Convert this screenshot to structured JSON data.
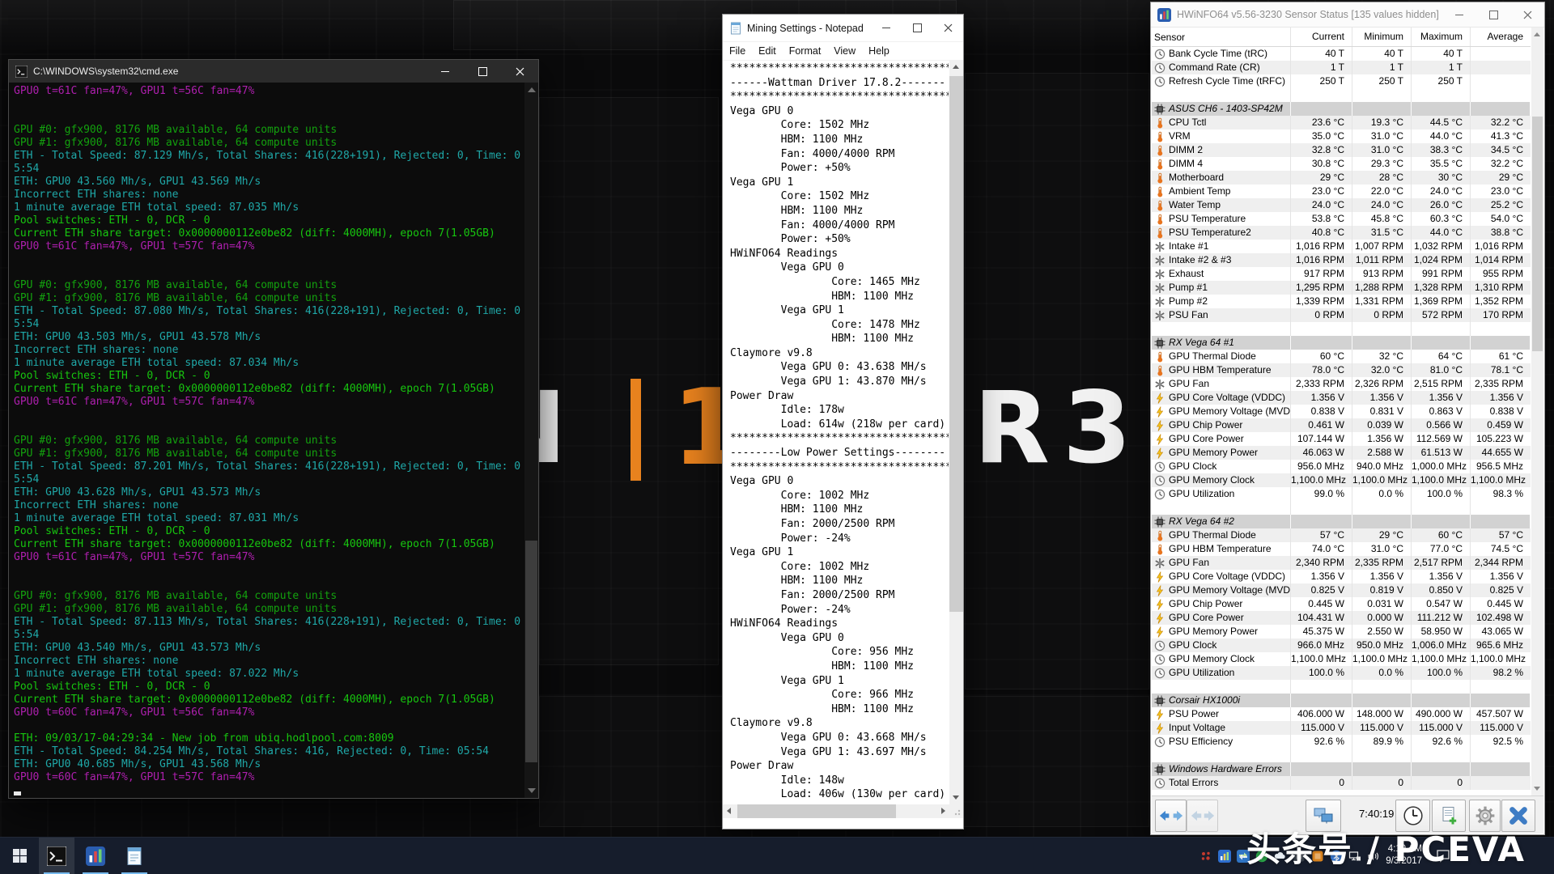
{
  "wallpaper": {
    "letter_n": "N",
    "digit_one": "1",
    "letters_r3": "R3"
  },
  "watermark": {
    "text": "头条号 / PCEVA"
  },
  "cmd": {
    "title": "C:\\WINDOWS\\system32\\cmd.exe",
    "lines": [
      {
        "t": "GPU0 t=61C fan=47%, GPU1 t=56C fan=47%",
        "c": "m"
      },
      {
        "t": ""
      },
      {
        "t": ""
      },
      {
        "t": "GPU #0: gfx900, 8176 MB available, 64 compute units",
        "c": "g"
      },
      {
        "t": "GPU #1: gfx900, 8176 MB available, 64 compute units",
        "c": "g"
      },
      {
        "t": "ETH - Total Speed: 87.129 Mh/s, Total Shares: 416(228+191), Rejected: 0, Time: 0",
        "c": "c"
      },
      {
        "t": "5:54",
        "c": "c"
      },
      {
        "t": "ETH: GPU0 43.560 Mh/s, GPU1 43.569 Mh/s",
        "c": "c"
      },
      {
        "t": "Incorrect ETH shares: none",
        "c": "c"
      },
      {
        "t": "1 minute average ETH total speed: 87.035 Mh/s",
        "c": "c"
      },
      {
        "t": "Pool switches: ETH - 0, DCR - 0",
        "c": "b"
      },
      {
        "t": "Current ETH share target: 0x0000000112e0be82 (diff: 4000MH), epoch 7(1.05GB)",
        "c": "b"
      },
      {
        "t": "GPU0 t=61C fan=47%, GPU1 t=57C fan=47%",
        "c": "m"
      },
      {
        "t": ""
      },
      {
        "t": ""
      },
      {
        "t": "GPU #0: gfx900, 8176 MB available, 64 compute units",
        "c": "g"
      },
      {
        "t": "GPU #1: gfx900, 8176 MB available, 64 compute units",
        "c": "g"
      },
      {
        "t": "ETH - Total Speed: 87.080 Mh/s, Total Shares: 416(228+191), Rejected: 0, Time: 0",
        "c": "c"
      },
      {
        "t": "5:54",
        "c": "c"
      },
      {
        "t": "ETH: GPU0 43.503 Mh/s, GPU1 43.578 Mh/s",
        "c": "c"
      },
      {
        "t": "Incorrect ETH shares: none",
        "c": "c"
      },
      {
        "t": "1 minute average ETH total speed: 87.034 Mh/s",
        "c": "c"
      },
      {
        "t": "Pool switches: ETH - 0, DCR - 0",
        "c": "b"
      },
      {
        "t": "Current ETH share target: 0x0000000112e0be82 (diff: 4000MH), epoch 7(1.05GB)",
        "c": "b"
      },
      {
        "t": "GPU0 t=61C fan=47%, GPU1 t=57C fan=47%",
        "c": "m"
      },
      {
        "t": ""
      },
      {
        "t": ""
      },
      {
        "t": "GPU #0: gfx900, 8176 MB available, 64 compute units",
        "c": "g"
      },
      {
        "t": "GPU #1: gfx900, 8176 MB available, 64 compute units",
        "c": "g"
      },
      {
        "t": "ETH - Total Speed: 87.201 Mh/s, Total Shares: 416(228+191), Rejected: 0, Time: 0",
        "c": "c"
      },
      {
        "t": "5:54",
        "c": "c"
      },
      {
        "t": "ETH: GPU0 43.628 Mh/s, GPU1 43.573 Mh/s",
        "c": "c"
      },
      {
        "t": "Incorrect ETH shares: none",
        "c": "c"
      },
      {
        "t": "1 minute average ETH total speed: 87.031 Mh/s",
        "c": "c"
      },
      {
        "t": "Pool switches: ETH - 0, DCR - 0",
        "c": "b"
      },
      {
        "t": "Current ETH share target: 0x0000000112e0be82 (diff: 4000MH), epoch 7(1.05GB)",
        "c": "b"
      },
      {
        "t": "GPU0 t=61C fan=47%, GPU1 t=57C fan=47%",
        "c": "m"
      },
      {
        "t": ""
      },
      {
        "t": ""
      },
      {
        "t": "GPU #0: gfx900, 8176 MB available, 64 compute units",
        "c": "g"
      },
      {
        "t": "GPU #1: gfx900, 8176 MB available, 64 compute units",
        "c": "g"
      },
      {
        "t": "ETH - Total Speed: 87.113 Mh/s, Total Shares: 416(228+191), Rejected: 0, Time: 0",
        "c": "c"
      },
      {
        "t": "5:54",
        "c": "c"
      },
      {
        "t": "ETH: GPU0 43.540 Mh/s, GPU1 43.573 Mh/s",
        "c": "c"
      },
      {
        "t": "Incorrect ETH shares: none",
        "c": "c"
      },
      {
        "t": "1 minute average ETH total speed: 87.022 Mh/s",
        "c": "c"
      },
      {
        "t": "Pool switches: ETH - 0, DCR - 0",
        "c": "b"
      },
      {
        "t": "Current ETH share target: 0x0000000112e0be82 (diff: 4000MH), epoch 7(1.05GB)",
        "c": "b"
      },
      {
        "t": "GPU0 t=60C fan=47%, GPU1 t=56C fan=47%",
        "c": "m"
      },
      {
        "t": ""
      },
      {
        "t": "ETH: 09/03/17-04:29:34 - New job from ubiq.hodlpool.com:8009",
        "c": "b"
      },
      {
        "t": "ETH - Total Speed: 84.254 Mh/s, Total Shares: 416, Rejected: 0, Time: 05:54",
        "c": "c"
      },
      {
        "t": "ETH: GPU0 40.685 Mh/s, GPU1 43.568 Mh/s",
        "c": "c"
      },
      {
        "t": "GPU0 t=60C fan=47%, GPU1 t=57C fan=47%",
        "c": "m"
      },
      {
        "cursor": true
      }
    ]
  },
  "notepad": {
    "title": "Mining Settings - Notepad",
    "menu": [
      "File",
      "Edit",
      "Format",
      "View",
      "Help"
    ],
    "lines": [
      "***********************************",
      "------Wattman Driver 17.8.2-------",
      "***********************************",
      "Vega GPU 0",
      "        Core: 1502 MHz",
      "        HBM: 1100 MHz",
      "        Fan: 4000/4000 RPM",
      "        Power: +50%",
      "Vega GPU 1",
      "        Core: 1502 MHz",
      "        HBM: 1100 MHz",
      "        Fan: 4000/4000 RPM",
      "        Power: +50%",
      "HWiNFO64 Readings",
      "        Vega GPU 0",
      "                Core: 1465 MHz",
      "                HBM: 1100 MHz",
      "        Vega GPU 1",
      "                Core: 1478 MHz",
      "                HBM: 1100 MHz",
      "Claymore v9.8",
      "        Vega GPU 0: 43.638 MH/s",
      "        Vega GPU 1: 43.870 MH/s",
      "Power Draw",
      "        Idle: 178w",
      "        Load: 614w (218w per card)",
      "***********************************",
      "--------Low Power Settings--------",
      "***********************************",
      "Vega GPU 0",
      "        Core: 1002 MHz",
      "        HBM: 1100 MHz",
      "        Fan: 2000/2500 RPM",
      "        Power: -24%",
      "Vega GPU 1",
      "        Core: 1002 MHz",
      "        HBM: 1100 MHz",
      "        Fan: 2000/2500 RPM",
      "        Power: -24%",
      "HWiNFO64 Readings",
      "        Vega GPU 0",
      "                Core: 956 MHz",
      "                HBM: 1100 MHz",
      "        Vega GPU 1",
      "                Core: 966 MHz",
      "                HBM: 1100 MHz",
      "Claymore v9.8",
      "        Vega GPU 0: 43.668 MH/s",
      "        Vega GPU 1: 43.697 MH/s",
      "Power Draw",
      "        Idle: 148w",
      "        Load: 406w (130w per card)"
    ]
  },
  "hwinfo": {
    "title": "HWiNFO64 v5.56-3230 Sensor Status [135 values hidden]",
    "columns": [
      "Sensor",
      "Current",
      "Minimum",
      "Maximum",
      "Average"
    ],
    "toolbar": {
      "time": "7:40:19"
    },
    "groups": [
      {
        "rows": [
          {
            "icon": "clock",
            "label": "Bank Cycle Time (tRC)",
            "values": [
              "40 T",
              "40 T",
              "40 T",
              ""
            ]
          },
          {
            "icon": "clock",
            "label": "Command Rate (CR)",
            "values": [
              "1 T",
              "1 T",
              "1 T",
              ""
            ]
          },
          {
            "icon": "clock",
            "label": "Refresh Cycle Time (tRFC)",
            "values": [
              "250 T",
              "250 T",
              "250 T",
              ""
            ]
          }
        ]
      },
      {
        "name": "ASUS CH6 -  1403-SP42M",
        "rows": [
          {
            "icon": "thermo",
            "label": "CPU Tctl",
            "values": [
              "23.6 °C",
              "19.3 °C",
              "44.5 °C",
              "32.2 °C"
            ]
          },
          {
            "icon": "thermo",
            "label": "VRM",
            "values": [
              "35.0 °C",
              "31.0 °C",
              "44.0 °C",
              "41.3 °C"
            ]
          },
          {
            "icon": "thermo",
            "label": "DIMM 2",
            "values": [
              "32.8 °C",
              "31.0 °C",
              "38.3 °C",
              "34.5 °C"
            ]
          },
          {
            "icon": "thermo",
            "label": "DIMM 4",
            "values": [
              "30.8 °C",
              "29.3 °C",
              "35.5 °C",
              "32.2 °C"
            ]
          },
          {
            "icon": "thermo",
            "label": "Motherboard",
            "values": [
              "29 °C",
              "28 °C",
              "30 °C",
              "29 °C"
            ]
          },
          {
            "icon": "thermo",
            "label": "Ambient Temp",
            "values": [
              "23.0 °C",
              "22.0 °C",
              "24.0 °C",
              "23.0 °C"
            ]
          },
          {
            "icon": "thermo",
            "label": "Water Temp",
            "values": [
              "24.0 °C",
              "24.0 °C",
              "26.0 °C",
              "25.2 °C"
            ]
          },
          {
            "icon": "thermo",
            "label": "PSU Temperature",
            "values": [
              "53.8 °C",
              "45.8 °C",
              "60.3 °C",
              "54.0 °C"
            ]
          },
          {
            "icon": "thermo",
            "label": "PSU Temperature2",
            "values": [
              "40.8 °C",
              "31.5 °C",
              "44.0 °C",
              "38.8 °C"
            ]
          },
          {
            "icon": "fan",
            "label": "Intake #1",
            "values": [
              "1,016 RPM",
              "1,007 RPM",
              "1,032 RPM",
              "1,016 RPM"
            ]
          },
          {
            "icon": "fan",
            "label": "Intake #2 & #3",
            "values": [
              "1,016 RPM",
              "1,011 RPM",
              "1,024 RPM",
              "1,014 RPM"
            ]
          },
          {
            "icon": "fan",
            "label": "Exhaust",
            "values": [
              "917 RPM",
              "913 RPM",
              "991 RPM",
              "955 RPM"
            ]
          },
          {
            "icon": "fan",
            "label": "Pump #1",
            "values": [
              "1,295 RPM",
              "1,288 RPM",
              "1,328 RPM",
              "1,310 RPM"
            ]
          },
          {
            "icon": "fan",
            "label": "Pump #2",
            "values": [
              "1,339 RPM",
              "1,331 RPM",
              "1,369 RPM",
              "1,352 RPM"
            ]
          },
          {
            "icon": "fan",
            "label": "PSU Fan",
            "values": [
              "0 RPM",
              "0 RPM",
              "572 RPM",
              "170 RPM"
            ]
          }
        ]
      },
      {
        "name": "RX Vega 64 #1",
        "rows": [
          {
            "icon": "thermo",
            "label": "GPU Thermal Diode",
            "values": [
              "60 °C",
              "32 °C",
              "64 °C",
              "61 °C"
            ]
          },
          {
            "icon": "thermo",
            "label": "GPU HBM Temperature",
            "values": [
              "78.0 °C",
              "32.0 °C",
              "81.0 °C",
              "78.1 °C"
            ]
          },
          {
            "icon": "fan",
            "label": "GPU Fan",
            "values": [
              "2,333 RPM",
              "2,326 RPM",
              "2,515 RPM",
              "2,335 RPM"
            ]
          },
          {
            "icon": "bolt",
            "label": "GPU Core Voltage (VDDC)",
            "values": [
              "1.356 V",
              "1.356 V",
              "1.356 V",
              "1.356 V"
            ]
          },
          {
            "icon": "bolt",
            "label": "GPU Memory Voltage (MVDDC)",
            "values": [
              "0.838 V",
              "0.831 V",
              "0.863 V",
              "0.838 V"
            ]
          },
          {
            "icon": "bolt",
            "label": "GPU Chip Power",
            "values": [
              "0.461 W",
              "0.039 W",
              "0.566 W",
              "0.459 W"
            ]
          },
          {
            "icon": "bolt",
            "label": "GPU Core Power",
            "values": [
              "107.144 W",
              "1.356 W",
              "112.569 W",
              "105.223 W"
            ]
          },
          {
            "icon": "bolt",
            "label": "GPU Memory Power",
            "values": [
              "46.063 W",
              "2.588 W",
              "61.513 W",
              "44.655 W"
            ]
          },
          {
            "icon": "clock",
            "label": "GPU Clock",
            "values": [
              "956.0 MHz",
              "940.0 MHz",
              "1,000.0 MHz",
              "956.5 MHz"
            ]
          },
          {
            "icon": "clock",
            "label": "GPU Memory Clock",
            "values": [
              "1,100.0 MHz",
              "1,100.0 MHz",
              "1,100.0 MHz",
              "1,100.0 MHz"
            ]
          },
          {
            "icon": "clock",
            "label": "GPU Utilization",
            "values": [
              "99.0 %",
              "0.0 %",
              "100.0 %",
              "98.3 %"
            ]
          }
        ]
      },
      {
        "name": "RX Vega 64 #2",
        "rows": [
          {
            "icon": "thermo",
            "label": "GPU Thermal Diode",
            "values": [
              "57 °C",
              "29 °C",
              "60 °C",
              "57 °C"
            ]
          },
          {
            "icon": "thermo",
            "label": "GPU HBM Temperature",
            "values": [
              "74.0 °C",
              "31.0 °C",
              "77.0 °C",
              "74.5 °C"
            ]
          },
          {
            "icon": "fan",
            "label": "GPU Fan",
            "values": [
              "2,340 RPM",
              "2,335 RPM",
              "2,517 RPM",
              "2,344 RPM"
            ]
          },
          {
            "icon": "bolt",
            "label": "GPU Core Voltage (VDDC)",
            "values": [
              "1.356 V",
              "1.356 V",
              "1.356 V",
              "1.356 V"
            ]
          },
          {
            "icon": "bolt",
            "label": "GPU Memory Voltage (MVDDC)",
            "values": [
              "0.825 V",
              "0.819 V",
              "0.850 V",
              "0.825 V"
            ]
          },
          {
            "icon": "bolt",
            "label": "GPU Chip Power",
            "values": [
              "0.445 W",
              "0.031 W",
              "0.547 W",
              "0.445 W"
            ]
          },
          {
            "icon": "bolt",
            "label": "GPU Core Power",
            "values": [
              "104.431 W",
              "0.000 W",
              "111.212 W",
              "102.498 W"
            ]
          },
          {
            "icon": "bolt",
            "label": "GPU Memory Power",
            "values": [
              "45.375 W",
              "2.550 W",
              "58.950 W",
              "43.065 W"
            ]
          },
          {
            "icon": "clock",
            "label": "GPU Clock",
            "values": [
              "966.0 MHz",
              "950.0 MHz",
              "1,006.0 MHz",
              "965.6 MHz"
            ]
          },
          {
            "icon": "clock",
            "label": "GPU Memory Clock",
            "values": [
              "1,100.0 MHz",
              "1,100.0 MHz",
              "1,100.0 MHz",
              "1,100.0 MHz"
            ]
          },
          {
            "icon": "clock",
            "label": "GPU Utilization",
            "values": [
              "100.0 %",
              "0.0 %",
              "100.0 %",
              "98.2 %"
            ]
          }
        ]
      },
      {
        "name": "Corsair HX1000i",
        "rows": [
          {
            "icon": "bolt",
            "label": "PSU Power",
            "values": [
              "406.000 W",
              "148.000 W",
              "490.000 W",
              "457.507 W"
            ]
          },
          {
            "icon": "bolt",
            "label": "Input Voltage",
            "values": [
              "115.000 V",
              "115.000 V",
              "115.000 V",
              "115.000 V"
            ]
          },
          {
            "icon": "clock",
            "label": "PSU Efficiency",
            "values": [
              "92.6 %",
              "89.9 %",
              "92.6 %",
              "92.5 %"
            ]
          }
        ]
      },
      {
        "name": "Windows Hardware Errors",
        "rows": [
          {
            "icon": "clock",
            "label": "Total Errors",
            "values": [
              "0",
              "0",
              "0",
              ""
            ]
          }
        ]
      }
    ]
  },
  "taskbar": {
    "tray_time": "4:19 AM",
    "tray_date": "9/3/2017",
    "tray_icons": [
      {
        "name": "miner-tray-icon",
        "shape": "dots",
        "color": "#c23a2e"
      },
      {
        "name": "hwinfo-tray-icon",
        "shape": "bars",
        "color": "#2e6fd0"
      },
      {
        "name": "sync-arrows-tray-icon",
        "shape": "arrows",
        "color": "#2ba84a"
      },
      {
        "name": "security-check-tray-icon",
        "shape": "check",
        "color": "#2ba84a"
      },
      {
        "name": "onedrive-tray-icon",
        "shape": "cloud",
        "color": "#e8eef4"
      },
      {
        "name": "media-app-tray-icon",
        "shape": "square",
        "color": "#3c4450"
      },
      {
        "name": "amd-settings-tray-icon",
        "shape": "square",
        "color": "#d8821e"
      },
      {
        "name": "bluetooth-tray-icon",
        "shape": "bt",
        "color": "#3a7bd5"
      },
      {
        "name": "network-tray-icon",
        "shape": "monitor",
        "color": "#e8e8e8"
      },
      {
        "name": "volume-tray-icon",
        "shape": "speaker",
        "color": "#e8e8e8"
      }
    ]
  }
}
